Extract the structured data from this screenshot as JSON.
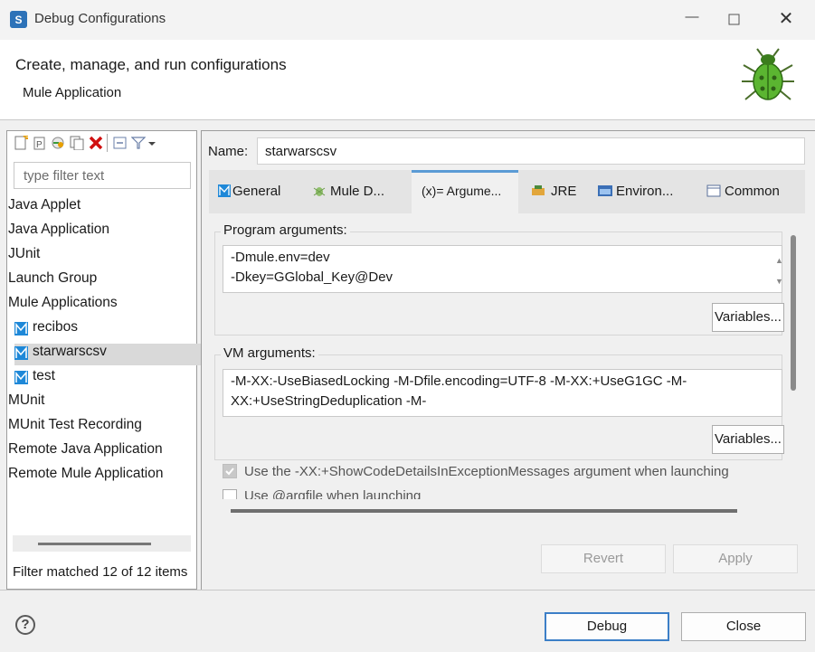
{
  "window": {
    "title": "Debug Configurations",
    "close_glyph": "✕",
    "min_glyph": "—"
  },
  "header": {
    "title": "Create, manage, and run configurations",
    "subtitle": "Mule Application"
  },
  "left": {
    "filter_placeholder": "type filter text",
    "tree": [
      {
        "label": "Java Applet"
      },
      {
        "label": "Java Application"
      },
      {
        "label": "JUnit"
      },
      {
        "label": "Launch Group"
      },
      {
        "label": "Mule Applications"
      },
      {
        "label": "recibos",
        "child": true
      },
      {
        "label": "starwarscsv",
        "child": true,
        "selected": true
      },
      {
        "label": "test",
        "child": true
      },
      {
        "label": "MUnit"
      },
      {
        "label": "MUnit Test Recording"
      },
      {
        "label": "Remote Java Application"
      },
      {
        "label": "Remote Mule Application"
      }
    ],
    "status": "Filter matched 12 of 12 items"
  },
  "right": {
    "name_label": "Name:",
    "name_value": "starwarscsv",
    "tabs": [
      "General",
      "Mule D...",
      "(x)= Argume...",
      "JRE",
      "Environ...",
      "Common"
    ],
    "program_args": {
      "label": "Program arguments:",
      "lines": [
        "-Dmule.env=dev",
        "-Dkey=GGlobal_Key@Dev"
      ],
      "variables": "Variables..."
    },
    "vm_args": {
      "label": "VM arguments:",
      "lines": [
        "-M-XX:-UseBiasedLocking -M-Dfile.encoding=UTF-8 -M-XX:+UseG1GC -M-",
        "XX:+UseStringDeduplication -M-"
      ],
      "variables": "Variables..."
    },
    "checkbox1": "Use the -XX:+ShowCodeDetailsInExceptionMessages argument when launching",
    "checkbox2": "Use @argfile when launching",
    "revert": "Revert",
    "apply": "Apply"
  },
  "footer": {
    "help_glyph": "?",
    "debug": "Debug",
    "close": "Close"
  },
  "colors": {
    "accent": "#5b9bd5",
    "mule_blue": "#1e88d8"
  }
}
